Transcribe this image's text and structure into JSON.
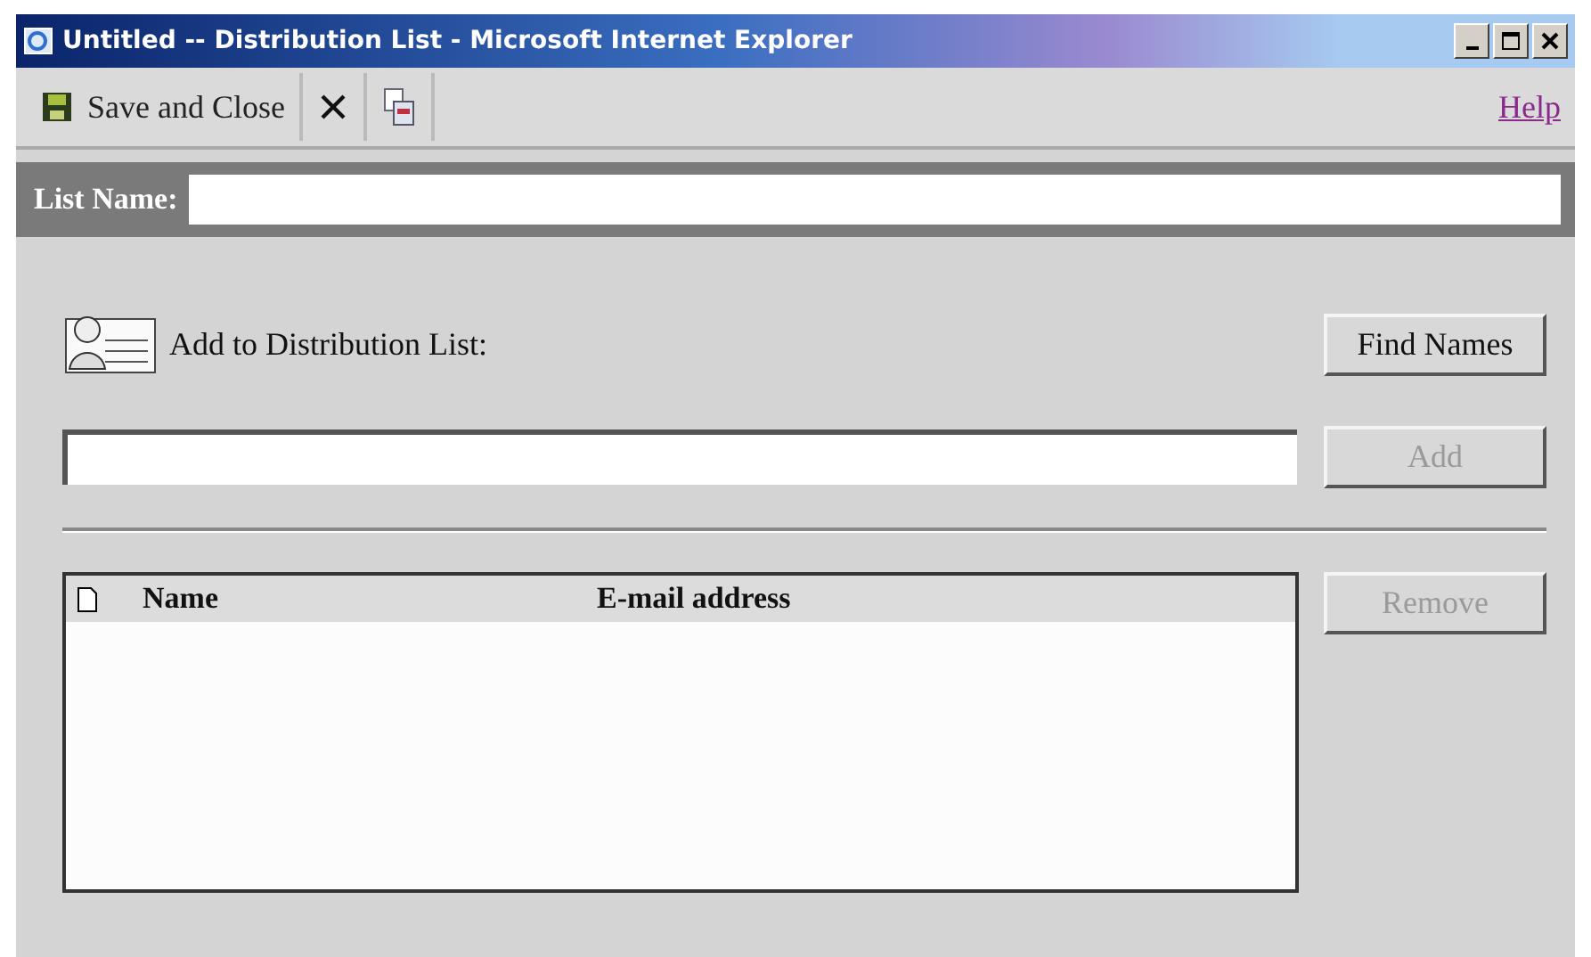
{
  "window": {
    "title": "Untitled -- Distribution List - Microsoft Internet Explorer"
  },
  "toolbar": {
    "save_and_close": "Save and Close",
    "help": "Help"
  },
  "list_name": {
    "label": "List Name:"
  },
  "add_section": {
    "label": "Add to Distribution List:",
    "buttons": [
      {
        "label": "Find Names",
        "disabled": false
      },
      {
        "label": "Add",
        "disabled": true
      }
    ]
  },
  "members": {
    "columns": [
      "Name",
      "E-mail address"
    ],
    "remove": {
      "label": "Remove",
      "disabled": true
    }
  }
}
